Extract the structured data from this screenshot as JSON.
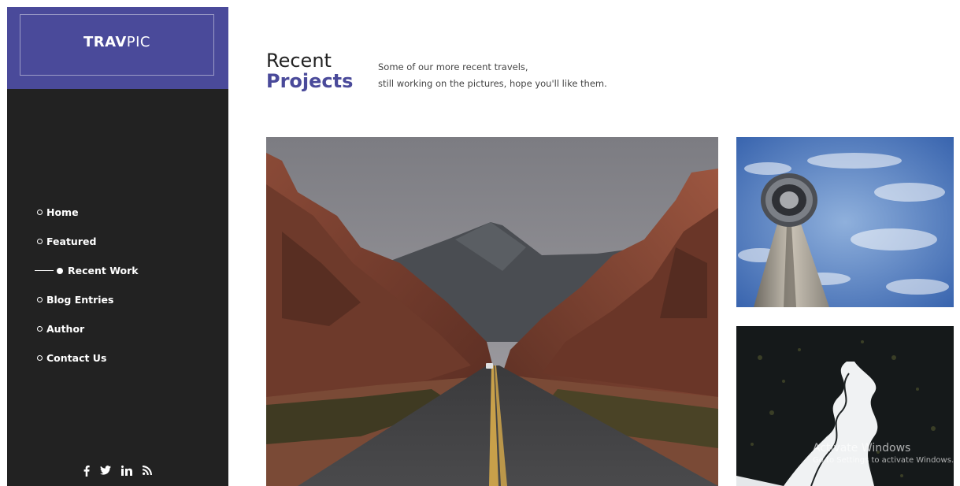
{
  "brand": {
    "bold": "TRAV",
    "light": "PIC"
  },
  "nav": [
    {
      "label": "Home"
    },
    {
      "label": "Featured"
    },
    {
      "label": "Recent Work"
    },
    {
      "label": "Blog Entries"
    },
    {
      "label": "Author"
    },
    {
      "label": "Contact Us"
    }
  ],
  "nav_active": "Recent Work",
  "social": [
    {
      "icon": "facebook-icon",
      "glyph": "f"
    },
    {
      "icon": "twitter-icon",
      "glyph": "🐦"
    },
    {
      "icon": "linkedin-icon",
      "glyph": "in"
    },
    {
      "icon": "rss-icon",
      "glyph": "))"
    }
  ],
  "section": {
    "title_line1": "Recent",
    "title_line2": "Projects",
    "description_line1": "Some of our more recent travels,",
    "description_line2": "still working on the pictures, hope you'll like them."
  },
  "gallery": [
    {
      "subject": "desert road through red rock canyon"
    },
    {
      "subject": "observation tower against cloudy blue sky"
    },
    {
      "subject": "aerial view of frozen winding river in dark forest"
    }
  ],
  "watermark": {
    "title": "Activate Windows",
    "subtitle": "Go to Settings to activate Windows."
  },
  "colors": {
    "accent": "#4a4a9a",
    "sidebar": "#222222",
    "text_dark": "#222222"
  }
}
